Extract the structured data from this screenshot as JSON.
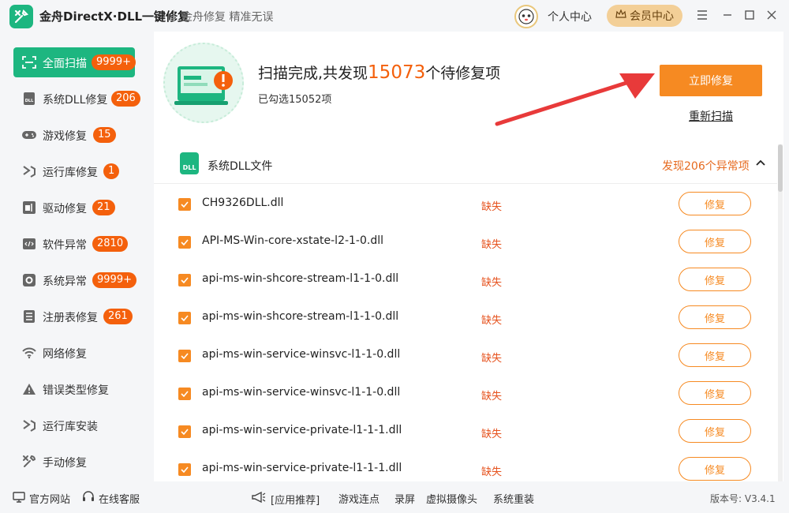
{
  "app": {
    "title": "金舟DirectX·DLL一键修复",
    "slogan": "金舟修复 精准无误",
    "personal_center": "个人中心",
    "vip_center": "会员中心"
  },
  "sidebar": {
    "items": [
      {
        "label": "全面扫描",
        "badge": "9999+",
        "icon": "scan-icon",
        "active": true
      },
      {
        "label": "系统DLL修复",
        "badge": "206",
        "icon": "dll-icon"
      },
      {
        "label": "游戏修复",
        "badge": "15",
        "icon": "gamepad-icon"
      },
      {
        "label": "运行库修复",
        "badge": "1",
        "icon": "runtime-icon"
      },
      {
        "label": "驱动修复",
        "badge": "21",
        "icon": "driver-icon"
      },
      {
        "label": "软件异常",
        "badge": "2810",
        "icon": "code-icon"
      },
      {
        "label": "系统异常",
        "badge": "9999+",
        "icon": "gear-icon"
      },
      {
        "label": "注册表修复",
        "badge": "261",
        "icon": "registry-icon"
      },
      {
        "label": "网络修复",
        "badge": "",
        "icon": "wifi-icon"
      },
      {
        "label": "错误类型修复",
        "badge": "",
        "icon": "warning-icon"
      },
      {
        "label": "运行库安装",
        "badge": "",
        "icon": "install-icon"
      },
      {
        "label": "手动修复",
        "badge": "",
        "icon": "wrench-icon"
      }
    ]
  },
  "scan": {
    "title_prefix": "扫描完成,共发现",
    "count": "15073",
    "title_suffix": "个待修复项",
    "selected": "已勾选15052项",
    "fix_now": "立即修复",
    "rescan": "重新扫描"
  },
  "list": {
    "title": "系统DLL文件",
    "found": "发现206个异常项",
    "icon_text": "DLL",
    "rows": [
      {
        "name": "CH9326DLL.dll",
        "status": "缺失",
        "action": "修复"
      },
      {
        "name": "API-MS-Win-core-xstate-l2-1-0.dll",
        "status": "缺失",
        "action": "修复"
      },
      {
        "name": "api-ms-win-shcore-stream-l1-1-0.dll",
        "status": "缺失",
        "action": "修复"
      },
      {
        "name": "api-ms-win-shcore-stream-l1-1-0.dll",
        "status": "缺失",
        "action": "修复"
      },
      {
        "name": "api-ms-win-service-winsvc-l1-1-0.dll",
        "status": "缺失",
        "action": "修复"
      },
      {
        "name": "api-ms-win-service-winsvc-l1-1-0.dll",
        "status": "缺失",
        "action": "修复"
      },
      {
        "name": "api-ms-win-service-private-l1-1-1.dll",
        "status": "缺失",
        "action": "修复"
      },
      {
        "name": "api-ms-win-service-private-l1-1-1.dll",
        "status": "缺失",
        "action": "修复"
      }
    ]
  },
  "footer": {
    "website": "官方网站",
    "support": "在线客服",
    "recommend": "[应用推荐]",
    "links": [
      "游戏连点",
      "录屏",
      "虚拟摄像头",
      "系统重装"
    ],
    "version": "版本号: V3.4.1"
  },
  "colors": {
    "brand_green": "#1db680",
    "accent_orange": "#f68a22",
    "badge_orange": "#f4600c"
  }
}
